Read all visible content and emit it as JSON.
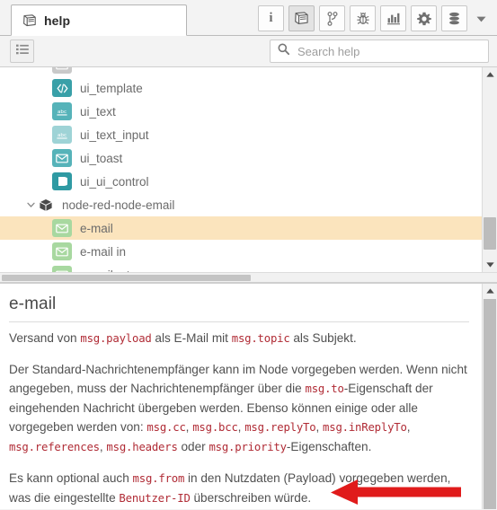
{
  "window": {
    "tab": {
      "label": "help",
      "icon": "book-icon"
    }
  },
  "toolbar": {
    "buttons": [
      {
        "name": "info",
        "icon": "info-icon",
        "title": "i",
        "active": false
      },
      {
        "name": "help",
        "icon": "book-icon",
        "title": "help",
        "active": true
      },
      {
        "name": "flows",
        "icon": "git-branch-icon",
        "title": "flows",
        "active": false
      },
      {
        "name": "debug",
        "icon": "bug-icon",
        "title": "debug",
        "active": false
      },
      {
        "name": "dashboard",
        "icon": "bar-chart-icon",
        "title": "dashboard",
        "active": false
      },
      {
        "name": "config",
        "icon": "gear-icon",
        "title": "config",
        "active": false
      },
      {
        "name": "context",
        "icon": "database-icon",
        "title": "context",
        "active": false
      }
    ],
    "more_icon": "caret-down-icon"
  },
  "search": {
    "list_toggle_icon": "list-icon",
    "icon": "search-icon",
    "placeholder": "Search help",
    "value": ""
  },
  "tree": {
    "rows": [
      {
        "label": "",
        "icon": "node-icon",
        "color": "#c9c9c9",
        "indent": 0,
        "twisty": "",
        "kind": "node",
        "selected": false,
        "partial": true
      },
      {
        "label": "ui_template",
        "icon": "code-icon",
        "color": "#39a0a8",
        "indent": 0,
        "twisty": "",
        "kind": "node",
        "selected": false
      },
      {
        "label": "ui_text",
        "icon": "abc-icon",
        "color": "#56b3b9",
        "indent": 0,
        "twisty": "",
        "kind": "node",
        "selected": false
      },
      {
        "label": "ui_text_input",
        "icon": "abc-icon",
        "color": "#9ed3d6",
        "indent": 0,
        "twisty": "",
        "kind": "node",
        "selected": false
      },
      {
        "label": "ui_toast",
        "icon": "envelope-icon",
        "color": "#56b3b9",
        "indent": 0,
        "twisty": "",
        "kind": "node",
        "selected": false
      },
      {
        "label": "ui_ui_control",
        "icon": "control-icon",
        "color": "#2f9aa3",
        "indent": 0,
        "twisty": "",
        "kind": "node",
        "selected": false
      },
      {
        "label": "node-red-node-email",
        "icon": "package-icon",
        "color": "",
        "indent": 0,
        "twisty": "chevron-down-icon",
        "kind": "package",
        "selected": false
      },
      {
        "label": "e-mail",
        "icon": "envelope-icon",
        "color": "#a8d8a0",
        "indent": 0,
        "twisty": "",
        "kind": "node",
        "selected": true
      },
      {
        "label": "e-mail in",
        "icon": "envelope-icon",
        "color": "#a8d8a0",
        "indent": 0,
        "twisty": "",
        "kind": "node",
        "selected": false
      },
      {
        "label": "e-mail mta",
        "icon": "envelope-icon",
        "color": "#a8d8a0",
        "indent": 0,
        "twisty": "",
        "kind": "node",
        "selected": false
      }
    ],
    "scrollbar": {
      "up_icon": "caret-up-icon",
      "down_icon": "caret-down-icon"
    }
  },
  "help": {
    "title": "e-mail",
    "paragraphs": [
      [
        {
          "t": "text",
          "v": "Versand von "
        },
        {
          "t": "code",
          "v": "msg.payload"
        },
        {
          "t": "text",
          "v": " als E-Mail mit "
        },
        {
          "t": "code",
          "v": "msg.topic"
        },
        {
          "t": "text",
          "v": " als Subjekt."
        }
      ],
      [
        {
          "t": "text",
          "v": "Der Standard-Nachrichtenempfänger kann im Node vorgegeben werden. Wenn nicht angegeben, muss der Nachrichtenempfänger über die "
        },
        {
          "t": "code",
          "v": "msg.to"
        },
        {
          "t": "text",
          "v": "-Eigenschaft der eingehenden Nachricht übergeben werden. Ebenso können einige oder alle vorgegeben werden von: "
        },
        {
          "t": "code",
          "v": "msg.cc"
        },
        {
          "t": "text",
          "v": ", "
        },
        {
          "t": "code",
          "v": "msg.bcc"
        },
        {
          "t": "text",
          "v": ", "
        },
        {
          "t": "code",
          "v": "msg.replyTo"
        },
        {
          "t": "text",
          "v": ", "
        },
        {
          "t": "code",
          "v": "msg.inReplyTo"
        },
        {
          "t": "text",
          "v": ", "
        },
        {
          "t": "code",
          "v": "msg.references"
        },
        {
          "t": "text",
          "v": ", "
        },
        {
          "t": "code",
          "v": "msg.headers"
        },
        {
          "t": "text",
          "v": " oder "
        },
        {
          "t": "code",
          "v": "msg.priority"
        },
        {
          "t": "text",
          "v": "-Eigenschaften."
        }
      ],
      [
        {
          "t": "text",
          "v": "Es kann optional auch "
        },
        {
          "t": "code",
          "v": "msg.from"
        },
        {
          "t": "text",
          "v": " in den Nutzdaten (Payload) vorgegeben werden, was die eingestellte "
        },
        {
          "t": "code",
          "v": "Benutzer-ID"
        },
        {
          "t": "text",
          "v": " überschreiben würde."
        }
      ]
    ],
    "scrollbar": {
      "up_icon": "caret-up-icon"
    }
  },
  "annotation": {
    "arrow_color": "#e01b1b",
    "direction": "left"
  },
  "colors": {
    "selected_row": "#fbe4bd",
    "code_text": "#b02b35",
    "body_text": "#505050",
    "chrome": "#f3f3f3"
  }
}
